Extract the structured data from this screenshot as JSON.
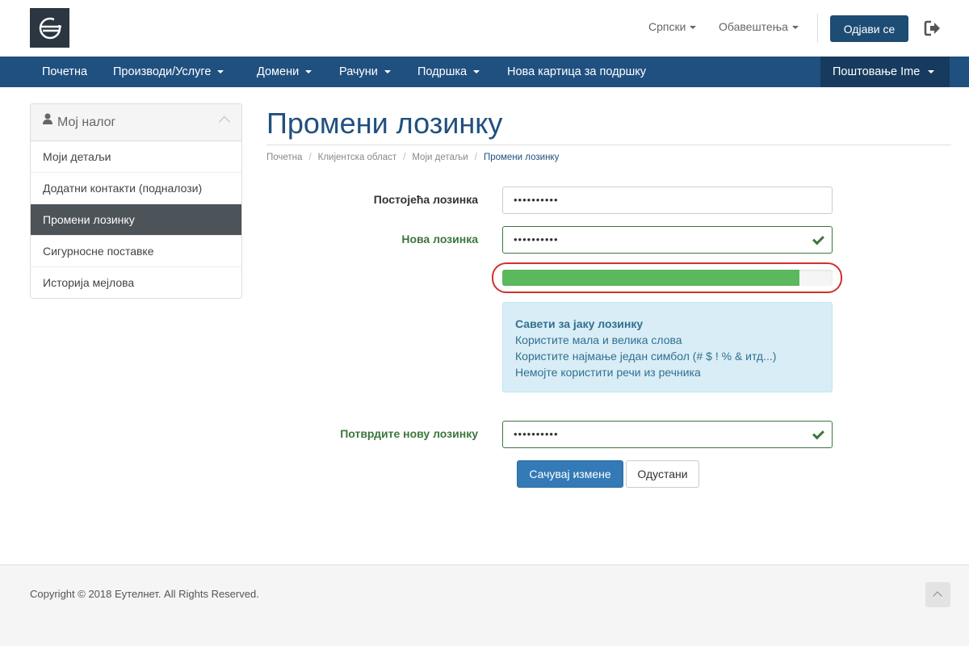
{
  "header": {
    "language_label": "Српски",
    "notifications_label": "Обавештења",
    "logout_label": "Одјави се"
  },
  "nav": {
    "items": [
      {
        "label": "Почетна",
        "dropdown": false
      },
      {
        "label": "Производи/Услуге",
        "dropdown": true
      },
      {
        "label": "Домени",
        "dropdown": true
      },
      {
        "label": "Рачуни",
        "dropdown": true
      },
      {
        "label": "Подршка",
        "dropdown": true
      },
      {
        "label": "Нова картица за подршку",
        "dropdown": false
      }
    ],
    "account_label": "Поштовање Ime"
  },
  "sidebar": {
    "title": "Мој налог",
    "items": [
      {
        "label": "Моји детаљи",
        "active": false
      },
      {
        "label": "Додатни контакти (подналози)",
        "active": false
      },
      {
        "label": "Промени лозинку",
        "active": true
      },
      {
        "label": "Сигурносне поставке",
        "active": false
      },
      {
        "label": "Историја мејлова",
        "active": false
      }
    ]
  },
  "page": {
    "title": "Промени лозинку",
    "breadcrumb": [
      "Почетна",
      "Клијентска област",
      "Моји детаљи",
      "Промени лозинку"
    ]
  },
  "form": {
    "current_password": {
      "label": "Постојећа лозинка",
      "value": "••••••••••"
    },
    "new_password": {
      "label": "Нова лозинка",
      "value": "••••••••••",
      "valid": true
    },
    "strength_fraction": 0.9,
    "tips": {
      "title": "Савети за јаку лозинку",
      "lines": [
        "Користите мала и велика слова",
        "Користите најмање један симбол (# $ ! % & итд...)",
        "Немојте користити речи из речника"
      ]
    },
    "confirm_password": {
      "label": "Потврдите нову лозинку",
      "value": "••••••••••",
      "valid": true
    },
    "save_label": "Сачувај измене",
    "cancel_label": "Одустани"
  },
  "footer": {
    "copyright": "Copyright © 2018 Еутелнет. All Rights Reserved."
  },
  "colors": {
    "brand": "#205080",
    "success": "#3c763d",
    "strength_bar": "#5cb85c",
    "highlight_ring": "#d0312d"
  }
}
